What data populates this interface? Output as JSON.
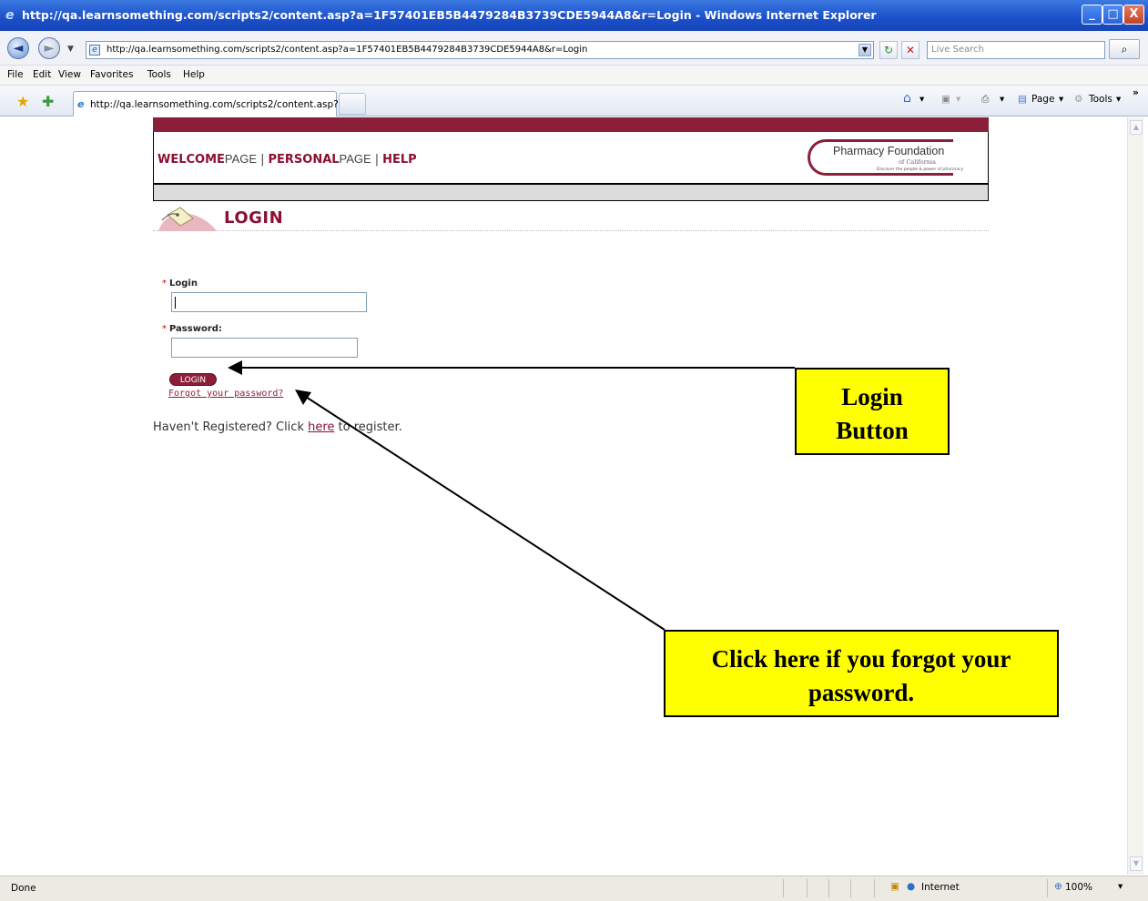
{
  "window": {
    "title": "http://qa.learnsomething.com/scripts2/content.asp?a=1F57401EB5B4479284B3739CDE5944A8&r=Login - Windows Internet Explorer",
    "minimize": "_",
    "maximize": "□",
    "close": "X"
  },
  "address": {
    "url": "http://qa.learnsomething.com/scripts2/content.asp?a=1F57401EB5B4479284B3739CDE5944A8&r=Login",
    "search_placeholder": "Live Search"
  },
  "menu": {
    "file": "File",
    "edit": "Edit",
    "view": "View",
    "favorites": "Favorites",
    "tools": "Tools",
    "help": "Help"
  },
  "tabs": {
    "active_label": "http://qa.learnsomething.com/scripts2/content.asp?a...",
    "page_cmd": "Page",
    "tools_cmd": "Tools"
  },
  "site": {
    "nav": {
      "welcome_strong": "WELCOME",
      "welcome_light": "PAGE",
      "personal_strong": "PERSONAL",
      "personal_light": "PAGE",
      "help": "HELP",
      "separator": "|"
    },
    "logo": {
      "name": "Pharmacy Foundation",
      "sub": "of California",
      "tagline": "Discover the people & power of pharmacy"
    },
    "login_title": "LOGIN",
    "form": {
      "required_mark": "*",
      "login_label": "Login",
      "password_label": "Password:",
      "login_button": "LOGIN",
      "forgot_link": "Forgot your password?",
      "register_prefix": "Haven't Registered? Click ",
      "register_link": "here",
      "register_suffix": " to register."
    }
  },
  "callouts": {
    "login_button_line1": "Login",
    "login_button_line2": "Button",
    "forgot_line1": "Click here if you forgot your",
    "forgot_line2": "password."
  },
  "status": {
    "text": "Done",
    "zone": "Internet",
    "zoom": "100%"
  },
  "colors": {
    "brand": "#8b1f3a",
    "callout": "#ffff00"
  }
}
